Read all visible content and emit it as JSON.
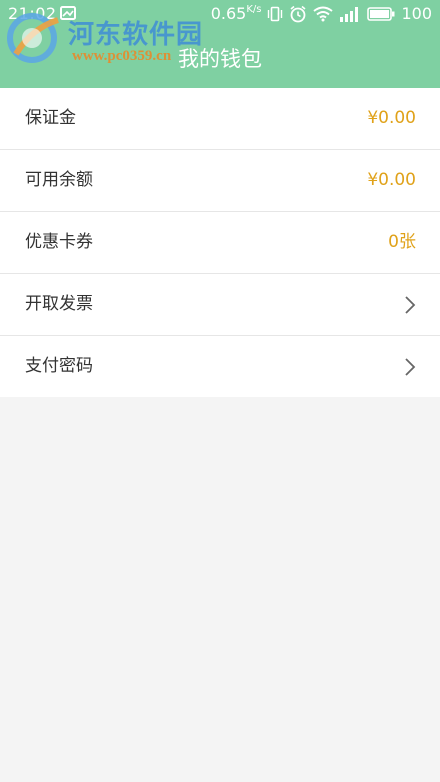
{
  "status_bar": {
    "time": "21:02",
    "net_speed": "0.65",
    "net_speed_unit": "K/s",
    "battery": "100",
    "icons": [
      "message-icon",
      "vibrate-icon",
      "alarm-icon",
      "wifi-icon",
      "signal-icon",
      "battery-icon"
    ]
  },
  "watermark": {
    "name": "河东软件园",
    "url": "www.pc0359.cn"
  },
  "header": {
    "title": "我的钱包",
    "background_color": "#7fd0a2"
  },
  "menu": {
    "items": [
      {
        "label": "保证金",
        "value": "¥0.00"
      },
      {
        "label": "可用余额",
        "value": "¥0.00"
      },
      {
        "label": "优惠卡券",
        "value": "0张"
      },
      {
        "label": "开取发票",
        "icon": "chevron-right-icon"
      },
      {
        "label": "支付密码",
        "icon": "chevron-right-icon"
      }
    ],
    "value_color": "#e0a21a"
  }
}
